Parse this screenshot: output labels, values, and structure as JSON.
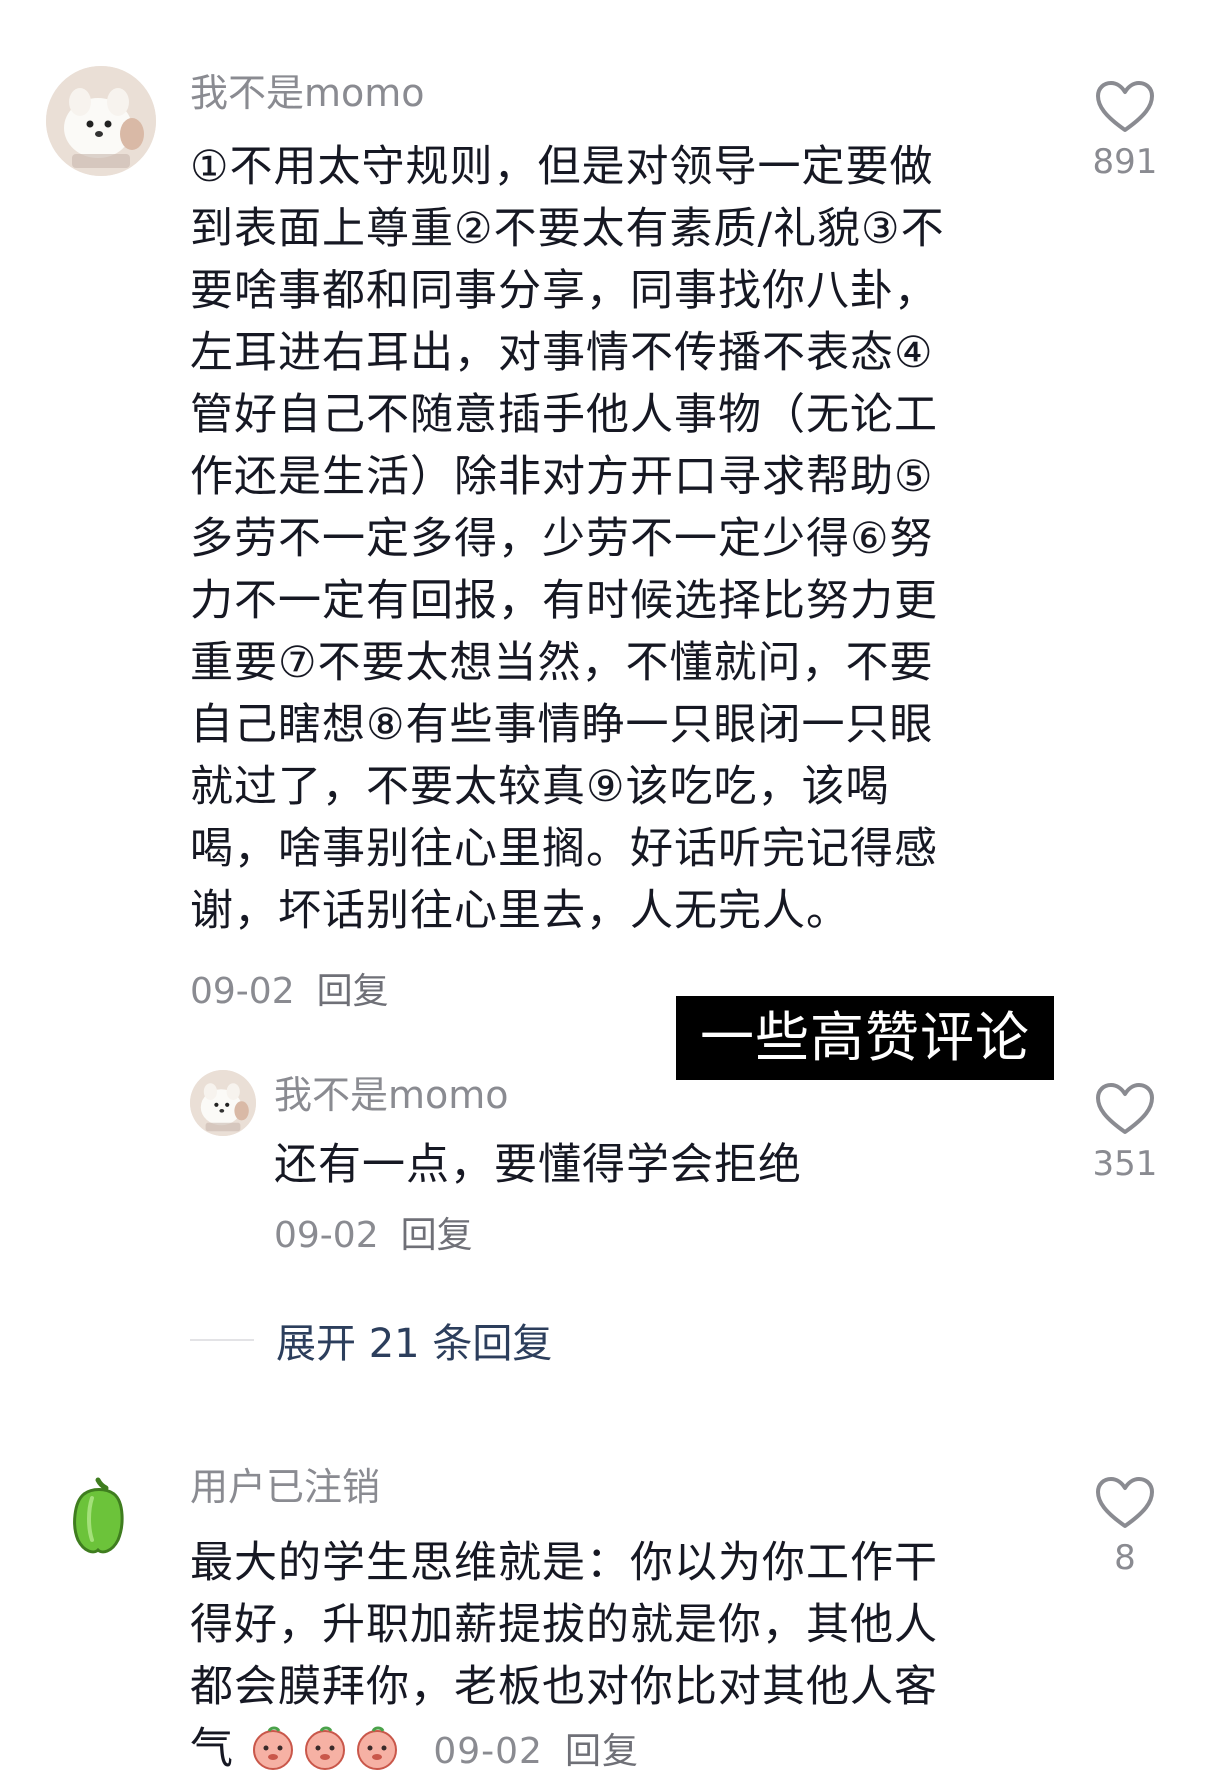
{
  "overlay": {
    "label": "一些高赞评论"
  },
  "comments": [
    {
      "username": "我不是momo",
      "text": "①不用太守规则，但是对领导一定要做到表面上尊重②不要太有素质/礼貌③不要啥事都和同事分享，同事找你八卦，左耳进右耳出，对事情不传播不表态④管好自己不随意插手他人事物（无论工作还是生活）除非对方开口寻求帮助⑤多劳不一定多得，少劳不一定少得⑥努力不一定有回报，有时候选择比努力更重要⑦不要太想当然，不懂就问，不要自己瞎想⑧有些事情睁一只眼闭一只眼就过了，不要太较真⑨该吃吃，该喝喝，啥事别往心里搁。好话听完记得感谢，坏话别往心里去，人无完人。",
      "lines": [
        "①不用太守规则，但是对领导一定要做",
        "到表面上尊重②不要太有素质/礼貌③不",
        "要啥事都和同事分享，同事找你八卦，",
        "左耳进右耳出，对事情不传播不表态④",
        "管好自己不随意插手他人事物（无论工",
        "作还是生活）除非对方开口寻求帮助⑤",
        "多劳不一定多得，少劳不一定少得⑥努",
        "力不一定有回报，有时候选择比努力更",
        "重要⑦不要太想当然，不懂就问，不要",
        "自己瞎想⑧有些事情睁一只眼闭一只眼",
        "就过了，不要太较真⑨该吃吃，该喝",
        "喝，啥事别往心里搁。好话听完记得感",
        "谢，坏话别往心里去，人无完人。"
      ],
      "date": "09-02",
      "reply_label": "回复",
      "likes": "891",
      "avatar_icon": "dog-avatar-icon"
    },
    {
      "username": "我不是momo",
      "text": "还有一点，要懂得学会拒绝",
      "date": "09-02",
      "reply_label": "回复",
      "likes": "351",
      "avatar_icon": "dog-avatar-icon"
    },
    {
      "username": "用户已注销",
      "lines": [
        "最大的学生思维就是：你以为你工作干",
        "得好，升职加薪提拔的就是你，其他人",
        "都会膜拜你，老板也对你比对其他人客",
        "气"
      ],
      "date": "09-02",
      "reply_label": "回复",
      "likes": "8",
      "avatar_icon": "green-pepper-icon",
      "emoji_icon": "peach-emoji-icon",
      "emoji_count": 3
    }
  ],
  "expand": {
    "label": "展开 21 条回复"
  },
  "colors": {
    "text": "#161823",
    "meta": "#8a8b91",
    "link": "#2c3e5c",
    "overlay_bg": "#000000"
  }
}
